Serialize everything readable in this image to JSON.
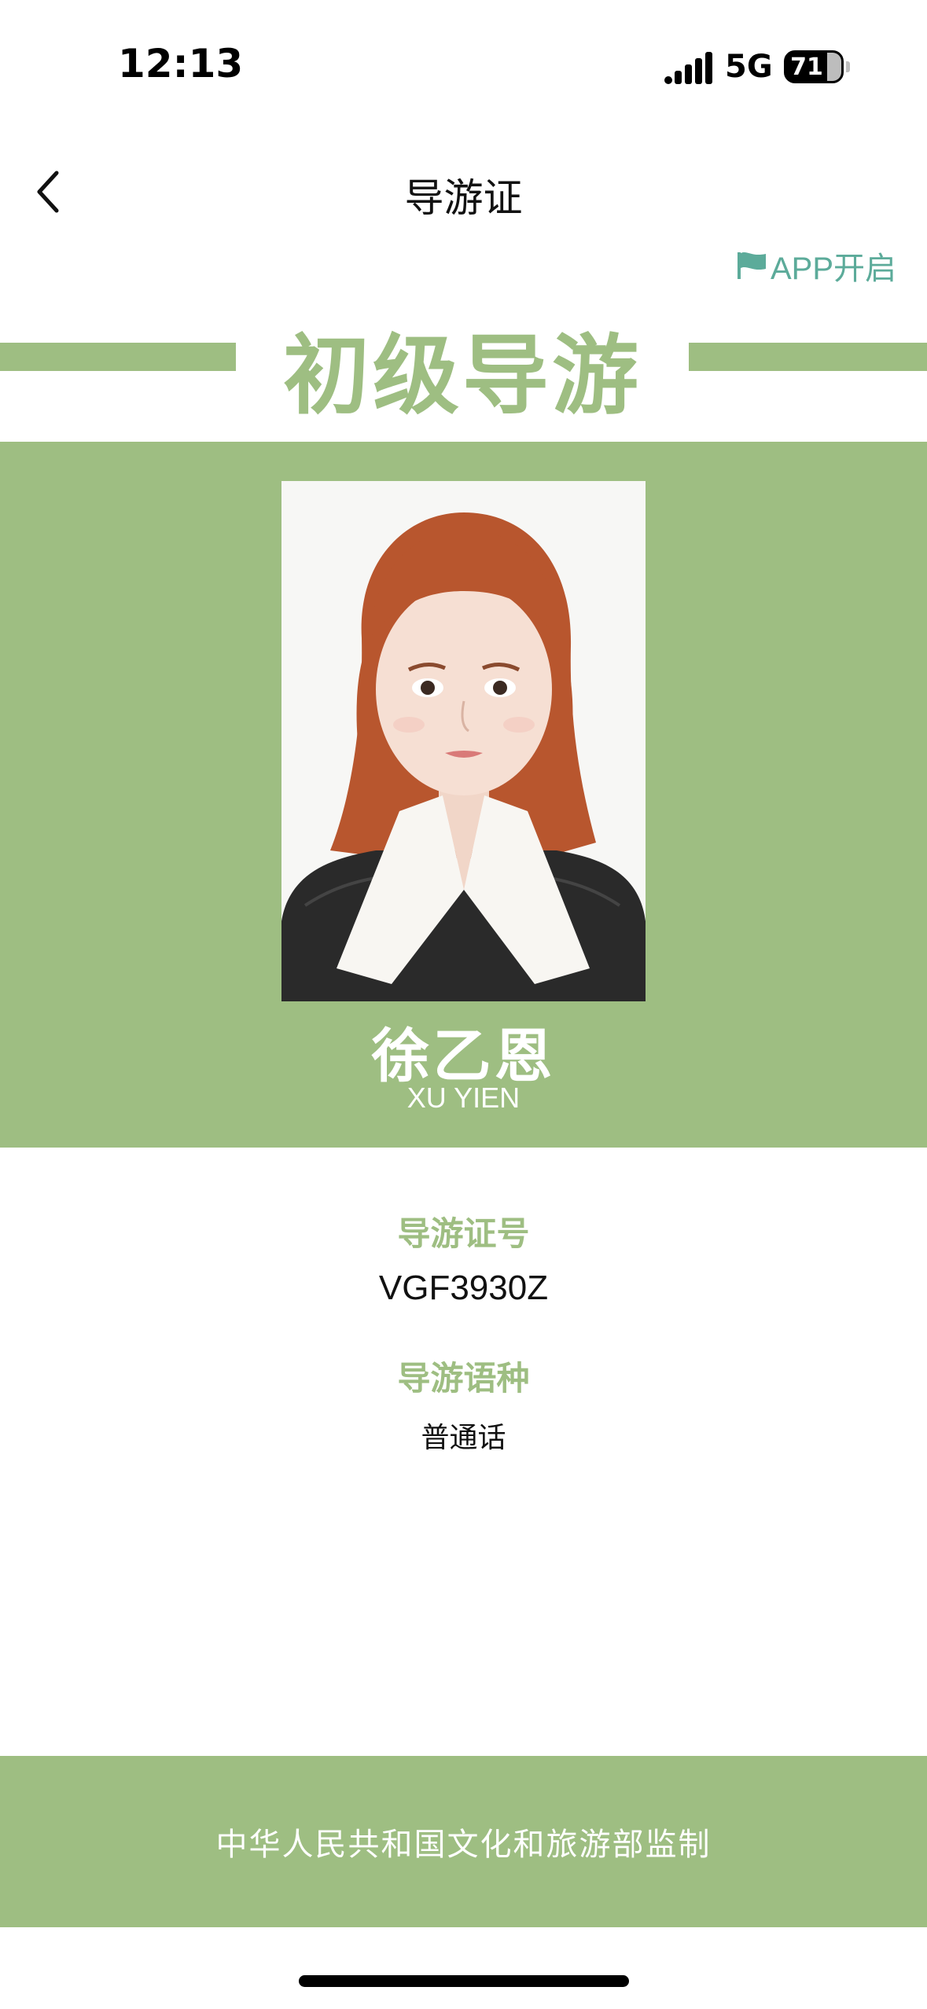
{
  "status_bar": {
    "time": "12:13",
    "network": "5G",
    "battery": "71",
    "signal_icon": "signal-bars-icon",
    "battery_icon": "battery-icon"
  },
  "nav": {
    "title": "导游证",
    "back_icon": "chevron-left-icon"
  },
  "app_open": {
    "label": "APP开启",
    "icon": "flag-icon",
    "color": "#5cab9a"
  },
  "card": {
    "level": "初级导游",
    "name_cn": "徐乙恩",
    "name_pinyin": "XU YIEN",
    "accent_color": "#9ebe82"
  },
  "fields": {
    "license_label": "导游证号",
    "license_value": "VGF3930Z",
    "language_label": "导游语种",
    "language_value": "普通话"
  },
  "footer": {
    "text": "中华人民共和国文化和旅游部监制"
  }
}
